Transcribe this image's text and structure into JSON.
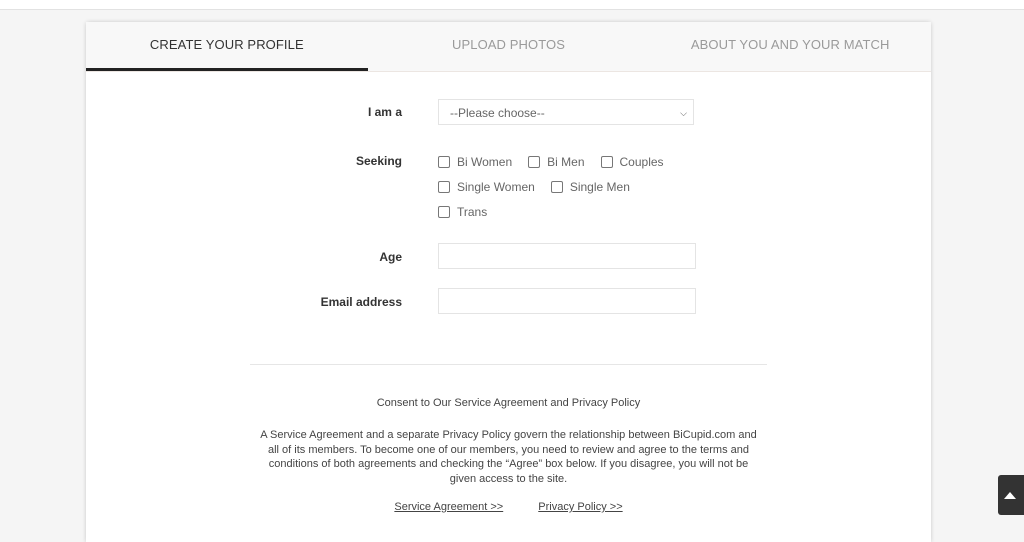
{
  "tabs": [
    {
      "label": "CREATE YOUR PROFILE",
      "active": true
    },
    {
      "label": "UPLOAD PHOTOS",
      "active": false
    },
    {
      "label": "ABOUT YOU AND YOUR MATCH",
      "active": false
    }
  ],
  "form": {
    "i_am_a": {
      "label": "I am a",
      "selected": "--Please choose--"
    },
    "seeking": {
      "label": "Seeking",
      "options": [
        "Bi Women",
        "Bi Men",
        "Couples",
        "Single Women",
        "Single Men",
        "Trans"
      ]
    },
    "age": {
      "label": "Age",
      "value": ""
    },
    "email": {
      "label": "Email address",
      "value": ""
    }
  },
  "consent": {
    "title": "Consent to Our Service Agreement and Privacy Policy",
    "body": "A Service Agreement and a separate Privacy Policy govern the relationship between BiCupid.com and all of its members. To become one of our members, you need to review and agree to the terms and conditions of both agreements and checking the “Agree” box below. If you disagree, you will not be given access to the site.",
    "links": [
      "Service Agreement >>",
      "Privacy Policy >>"
    ]
  },
  "scroll_top_icon": "triangle-up-icon"
}
